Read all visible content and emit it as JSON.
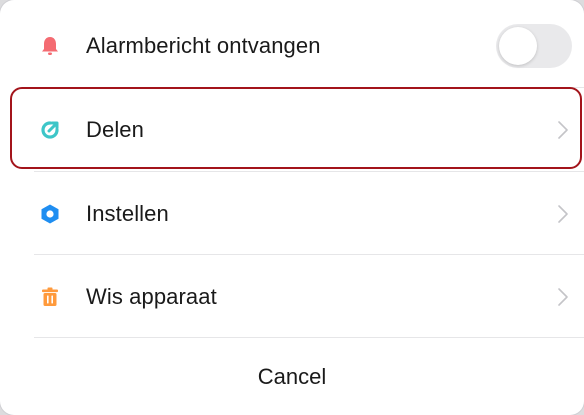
{
  "menu": {
    "items": [
      {
        "label": "Alarmbericht ontvangen",
        "icon": "bell-icon",
        "control": "toggle",
        "toggle_on": false
      },
      {
        "label": "Delen",
        "icon": "share-icon",
        "control": "chevron"
      },
      {
        "label": "Instellen",
        "icon": "settings-icon",
        "control": "chevron"
      },
      {
        "label": "Wis apparaat",
        "icon": "trash-icon",
        "control": "chevron"
      }
    ],
    "cancel_label": "Cancel"
  },
  "colors": {
    "bell": "#f46b72",
    "share": "#3dc6c8",
    "settings": "#1f8ef1",
    "trash": "#ff9a3c",
    "highlight": "#a3141b",
    "toggle_off": "#e9e9eb"
  }
}
